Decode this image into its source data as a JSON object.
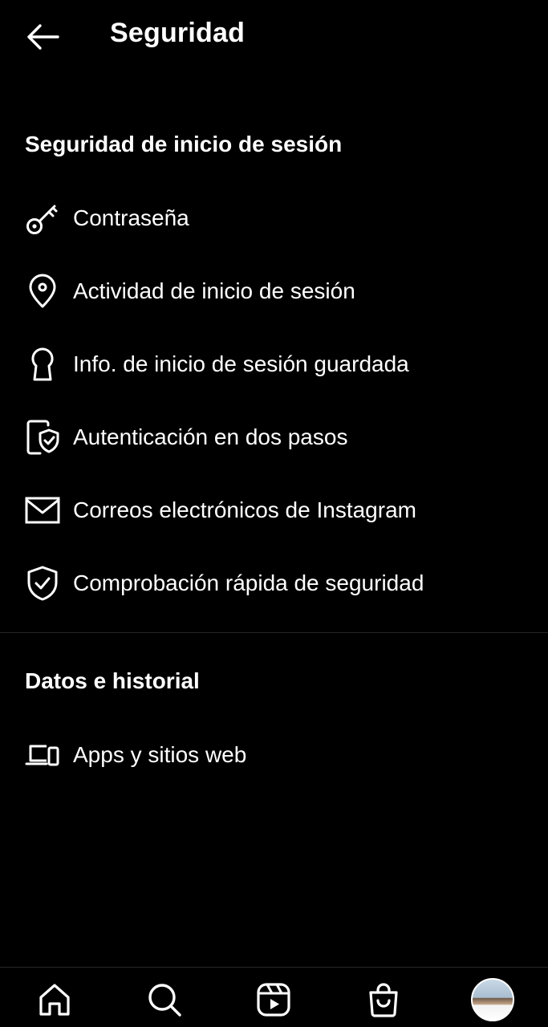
{
  "header": {
    "title": "Seguridad"
  },
  "sections": {
    "login": {
      "title": "Seguridad de inicio de sesión",
      "items": [
        {
          "label": "Contraseña",
          "icon": "key-icon"
        },
        {
          "label": "Actividad de inicio de sesión",
          "icon": "location-pin-icon"
        },
        {
          "label": "Info. de inicio de sesión guardada",
          "icon": "keyhole-icon"
        },
        {
          "label": "Autenticación en dos pasos",
          "icon": "phone-shield-icon"
        },
        {
          "label": "Correos electrónicos de Instagram",
          "icon": "mail-icon"
        },
        {
          "label": "Comprobación rápida de seguridad",
          "icon": "shield-check-icon"
        }
      ]
    },
    "data": {
      "title": "Datos e historial",
      "items": [
        {
          "label": "Apps y sitios web",
          "icon": "devices-icon"
        }
      ]
    }
  },
  "bottom_nav": {
    "items": [
      "home-icon",
      "search-icon",
      "reels-icon",
      "shop-icon",
      "profile-avatar"
    ]
  },
  "colors": {
    "background": "#000000",
    "text": "#ffffff",
    "divider": "#262626"
  }
}
